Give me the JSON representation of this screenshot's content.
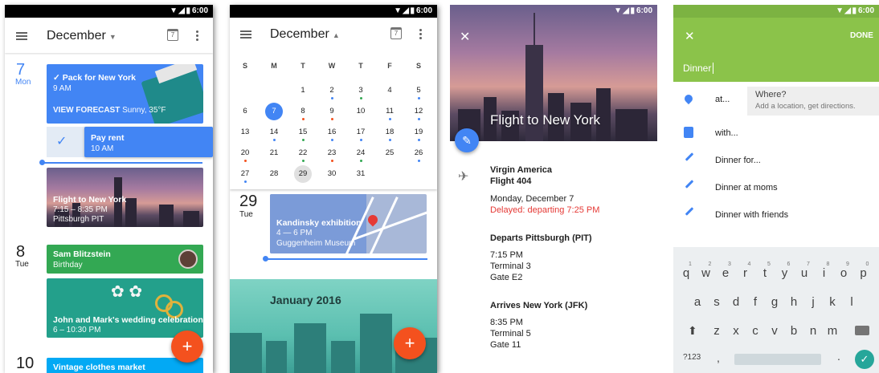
{
  "status": {
    "time": "6:00"
  },
  "screen1": {
    "title": "December",
    "calendar_icon_day": "7",
    "days": [
      {
        "num": "7",
        "label": "Mon"
      },
      {
        "num": "8",
        "label": "Tue"
      },
      {
        "num": "10"
      }
    ],
    "events": {
      "pack": {
        "title": "Pack for New York",
        "time": "9 AM",
        "forecast_action": "VIEW FORECAST",
        "forecast_text": "Sunny, 35°F"
      },
      "rent": {
        "title": "Pay rent",
        "time": "10 AM"
      },
      "flight": {
        "title": "Flight to New York",
        "time": "7:15 – 8:35 PM",
        "place": "Pittsburgh PIT"
      },
      "sam": {
        "title": "Sam Blitzstein",
        "sub": "Birthday"
      },
      "wedding": {
        "title": "John and Mark's wedding celebration",
        "time": "6 – 10:30 PM"
      },
      "vintage": {
        "title": "Vintage clothes market"
      }
    },
    "fab": "+",
    "colors": {
      "blue": "#4285f4",
      "green": "#33a853",
      "teal": "#23a08b",
      "cyan": "#03a9f4",
      "red": "#f4511e"
    }
  },
  "screen2": {
    "title": "December",
    "calendar_icon_day": "7",
    "weekdays": [
      "S",
      "M",
      "T",
      "W",
      "T",
      "F",
      "S"
    ],
    "weeks": [
      [
        "",
        "",
        "1",
        "2",
        "3",
        "4",
        "5"
      ],
      [
        "6",
        "7",
        "8",
        "9",
        "10",
        "11",
        "12"
      ],
      [
        "13",
        "14",
        "15",
        "16",
        "17",
        "18",
        "19"
      ],
      [
        "20",
        "21",
        "22",
        "23",
        "24",
        "25",
        "26"
      ],
      [
        "27",
        "28",
        "29",
        "30",
        "31",
        "",
        ""
      ]
    ],
    "selected_day": "29",
    "today": "7",
    "day_num": "29",
    "day_label": "Tue",
    "event": {
      "title": "Kandinsky exhibition",
      "time": "4 — 6 PM",
      "place": "Guggenheim Museum"
    },
    "month_banner": "January 2016",
    "fab": "+"
  },
  "screen3": {
    "header_title": "Flight to New York",
    "airline": "Virgin America",
    "flight": "Flight 404",
    "date": "Monday, December 7",
    "delay": "Delayed: departing 7:25 PM",
    "departs_title": "Departs Pittsburgh (PIT)",
    "departs_time": "7:15 PM",
    "departs_terminal": "Terminal 3",
    "departs_gate": "Gate E2",
    "arrives_title": "Arrives New York (JFK)",
    "arrives_time": "8:35 PM",
    "arrives_terminal": "Terminal 5",
    "arrives_gate": "Gate 11"
  },
  "screen4": {
    "done_label": "DONE",
    "input_value": "Dinner",
    "at_label": "at...",
    "where_title": "Where?",
    "where_sub": "Add a location, get directions.",
    "with_label": "with...",
    "suggestions": [
      "Dinner for...",
      "Dinner at moms",
      "Dinner with friends"
    ],
    "keyboard": {
      "row1": [
        "q",
        "w",
        "e",
        "r",
        "t",
        "y",
        "u",
        "i",
        "o",
        "p"
      ],
      "row1_sup": [
        "1",
        "2",
        "3",
        "4",
        "5",
        "6",
        "7",
        "8",
        "9",
        "0"
      ],
      "row2": [
        "a",
        "s",
        "d",
        "f",
        "g",
        "h",
        "j",
        "k",
        "l"
      ],
      "row3": [
        "z",
        "x",
        "c",
        "v",
        "b",
        "n",
        "m"
      ],
      "sym": "?123",
      "comma": ",",
      "period": "."
    },
    "colors": {
      "green": "#8bc34a",
      "gray": "#eeeeee"
    }
  }
}
